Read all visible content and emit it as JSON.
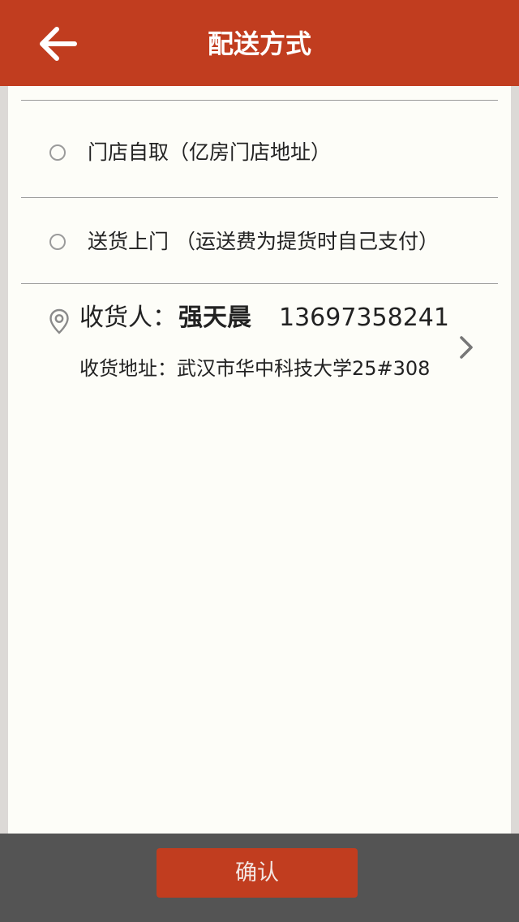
{
  "header": {
    "title": "配送方式",
    "back_icon": "arrow-left-icon"
  },
  "delivery_options": [
    {
      "label": "门店自取（亿房门店地址）",
      "selected": false
    },
    {
      "label": "送货上门 （运送费为提货时自己支付）",
      "selected": false
    }
  ],
  "address": {
    "receiver_label": "收货人：",
    "receiver_name": "强天晨",
    "phone": "13697358241",
    "address_text": "收货地址：武汉市华中科技大学25#308",
    "location_icon": "location-pin-icon",
    "chevron_icon": "chevron-right-icon"
  },
  "footer": {
    "confirm_label": "确认"
  },
  "colors": {
    "brand": "#c13d1f",
    "footer_bg": "#545454",
    "panel_bg": "#fdfdf8"
  }
}
